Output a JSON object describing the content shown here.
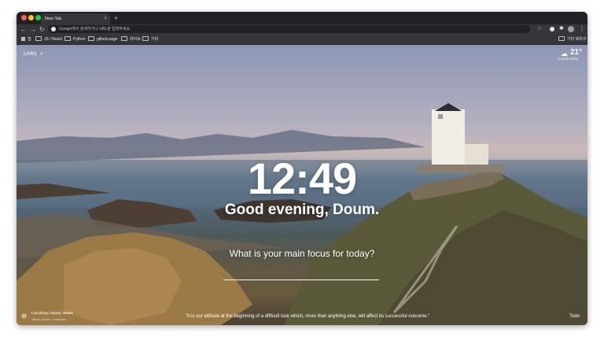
{
  "browser": {
    "tab": {
      "title": "New Tab",
      "close": "×"
    },
    "new_tab": "+",
    "nav": {
      "back": "←",
      "forward": "→",
      "reload": "↻"
    },
    "omnibox": {
      "placeholder": "Google에서 검색하거나 URL을 입력하세요."
    },
    "toolbar": {
      "star": "☆",
      "extensions": "✱",
      "menu": "⋮"
    },
    "bookmarks": {
      "items": [
        {
          "label": "앱",
          "icon": "apps-icon"
        },
        {
          "label": "JS / React",
          "icon": "folder-icon"
        },
        {
          "label": "Python",
          "icon": "folder-icon"
        },
        {
          "label": "github-page",
          "icon": "folder-icon"
        },
        {
          "label": "라이브",
          "icon": "folder-icon"
        },
        {
          "label": "기타",
          "icon": "folder-icon"
        }
      ],
      "other": "기타 북마크"
    }
  },
  "momentum": {
    "links_label": "Links",
    "search_icon": "search-icon",
    "weather": {
      "icon": "cloud-icon",
      "temperature": "21°",
      "location": "Juyeob-dong"
    },
    "clock": "12:49",
    "greeting": "Good evening, Doum.",
    "focus_question": "What is your main focus for today?",
    "photo": {
      "location": "Llanddwyn Island, Wales",
      "credit": "James Eades / Unsplash"
    },
    "quote": "\"It is our attitude at the beginning of a difficult task which, more than anything else, will affect its successful outcome.\"",
    "todo_label": "Todo"
  }
}
